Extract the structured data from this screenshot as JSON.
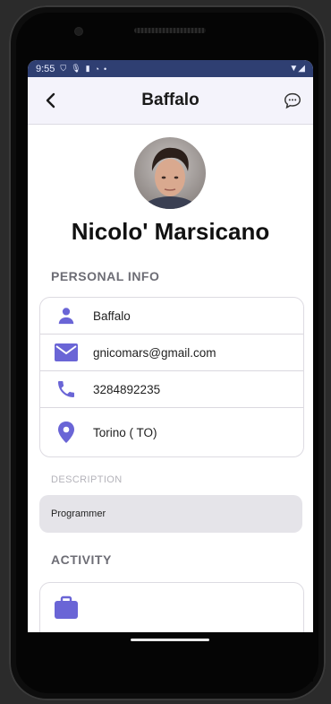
{
  "status_bar": {
    "time": "9:55",
    "icons": [
      "shield-icon",
      "mic-icon",
      "sd-card-icon",
      "sync-icon",
      "dot-icon"
    ],
    "right_icons": [
      "wifi-icon",
      "signal-icon"
    ]
  },
  "app_bar": {
    "title": "Baffalo",
    "back_icon": "chevron-left-icon",
    "chat_icon": "chat-bubble-icon"
  },
  "profile": {
    "full_name": "Nicolo' Marsicano"
  },
  "personal_info": {
    "heading": "PERSONAL INFO",
    "items": [
      {
        "icon": "person-icon",
        "value": "Baffalo"
      },
      {
        "icon": "mail-icon",
        "value": "gnicomars@gmail.com"
      },
      {
        "icon": "phone-icon",
        "value": "3284892235"
      },
      {
        "icon": "location-pin-icon",
        "value": "Torino ( TO)"
      }
    ]
  },
  "description": {
    "label": "DESCRIPTION",
    "value": "Programmer"
  },
  "activity": {
    "heading": "ACTIVITY",
    "icon": "briefcase-icon"
  },
  "colors": {
    "accent": "#6a65d6",
    "status_bar": "#2f3f72",
    "app_bar": "#f4f3fb"
  }
}
